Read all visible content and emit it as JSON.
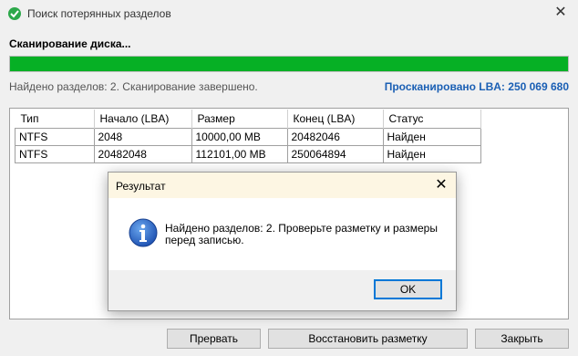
{
  "window": {
    "title": "Поиск потерянных разделов",
    "close": "✕"
  },
  "scan": {
    "heading": "Сканирование диска...",
    "progress": 1.0,
    "status": "Найдено разделов: 2. Сканирование завершено.",
    "lba": "Просканировано LBA: 250 069 680"
  },
  "table": {
    "headers": [
      "Тип",
      "Начало (LBA)",
      "Размер",
      "Конец (LBA)",
      "Статус"
    ],
    "rows": [
      [
        "NTFS",
        "2048",
        "10000,00 MB",
        "20482046",
        "Найден"
      ],
      [
        "NTFS",
        "20482048",
        "112101,00 MB",
        "250064894",
        "Найден"
      ]
    ]
  },
  "buttons": {
    "abort": "Прервать",
    "restore": "Восстановить разметку",
    "close": "Закрыть"
  },
  "dialog": {
    "title": "Результат",
    "close": "✕",
    "message": "Найдено разделов: 2. Проверьте разметку и размеры перед записью.",
    "ok": "OK"
  },
  "colors": {
    "progress": "#06b025",
    "lba": "#1a5fb4",
    "focus": "#0078d7"
  }
}
